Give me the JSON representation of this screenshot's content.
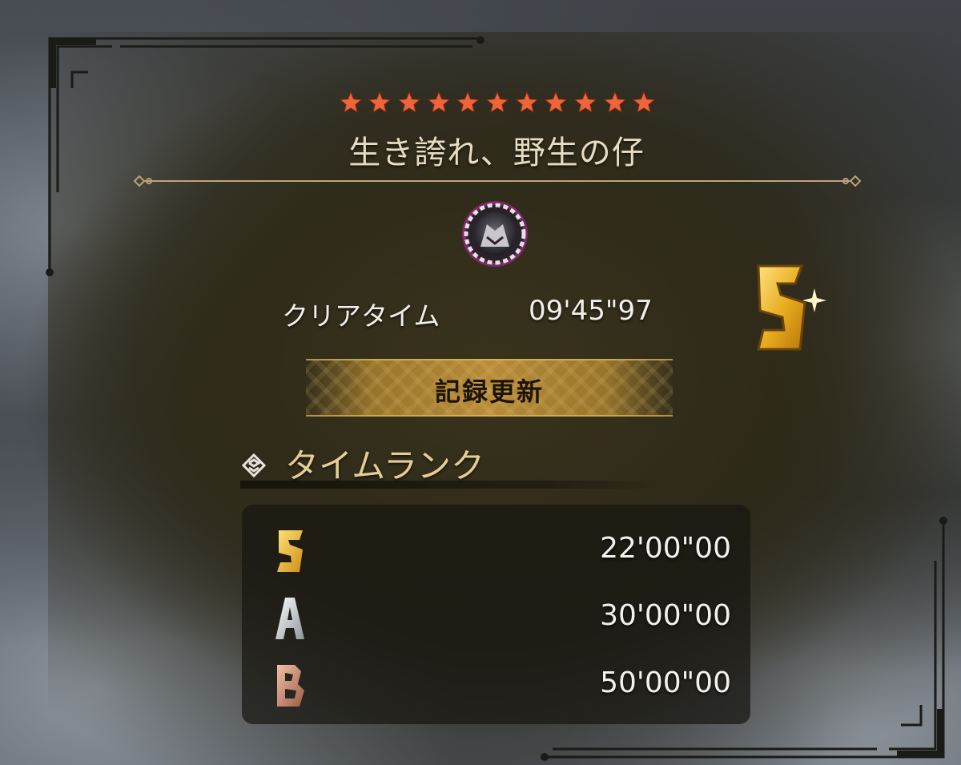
{
  "quest": {
    "stars": 11,
    "star_color": "#f0643c",
    "title": "生き誇れ、野生の仔",
    "emblem_icon": "monster-emblem-icon"
  },
  "result": {
    "clear_label": "クリアタイム",
    "clear_time": "09'45\"97",
    "rank": "S",
    "record_label": "記録更新"
  },
  "time_rank": {
    "section_icon": "rank-section-icon",
    "title": "タイムランク",
    "rows": [
      {
        "rank": "S",
        "time": "22'00\"00",
        "color": "#e8b52a"
      },
      {
        "rank": "A",
        "time": "30'00\"00",
        "color": "#c9cfd6"
      },
      {
        "rank": "B",
        "time": "50'00\"00",
        "color": "#c98a6e"
      }
    ]
  },
  "colors": {
    "accent_gold": "#e3ce95",
    "banner_gold": "#b88c3a",
    "text_light": "#f2f0ea"
  }
}
